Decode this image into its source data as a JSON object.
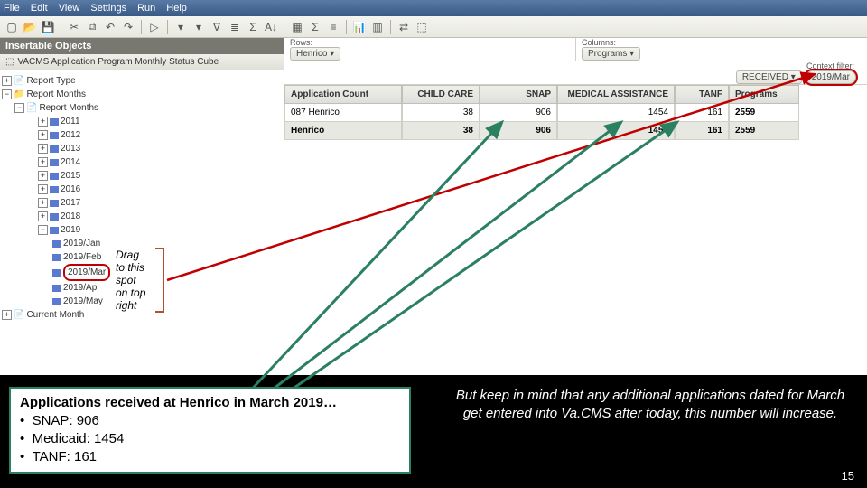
{
  "menu": {
    "items": [
      "File",
      "Edit",
      "View",
      "Settings",
      "Run",
      "Help"
    ]
  },
  "sidebar": {
    "title": "Insertable Objects",
    "source": "VACMS Application Program Monthly Status Cube",
    "top_items": [
      "Report Type",
      "Report Months"
    ],
    "years": [
      "2011",
      "2012",
      "2013",
      "2014",
      "2015",
      "2016",
      "2017",
      "2018",
      "2019"
    ],
    "months_2019": [
      "2019/Jan",
      "2019/Feb",
      "2019/Mar",
      "2019/Ap",
      "2019/May"
    ],
    "bottom_item": "Current Month"
  },
  "zones": {
    "rows_label": "Rows:",
    "rows_chip": "Henrico ▾",
    "cols_label": "Columns:",
    "cols_chip": "Programs ▾",
    "ctx_label": "Context filter:",
    "ctx_chip1": "RECEIVED ▾",
    "ctx_chip2": "2019/Mar"
  },
  "table": {
    "headers": [
      "Application Count",
      "CHILD CARE",
      "SNAP",
      "MEDICAL ASSISTANCE",
      "TANF",
      "Programs"
    ],
    "row1": {
      "label": "087   Henrico",
      "vals": [
        "38",
        "906",
        "1454",
        "161",
        "2559"
      ]
    },
    "row2": {
      "label": "Henrico",
      "vals": [
        "38",
        "906",
        "1454",
        "161",
        "2559"
      ]
    }
  },
  "drag_hint": {
    "l1": "Drag",
    "l2": "to this",
    "l3": "spot",
    "l4": "on top",
    "l5": "right"
  },
  "notes": {
    "left_title": "Applications received at Henrico in March 2019…",
    "left_b1": "SNAP:           906",
    "left_b2": "Medicaid:        1454",
    "left_b3": "TANF:                  161",
    "right": "But keep in mind that any additional applications dated for March get entered into Va.CMS after today, this number will increase."
  },
  "page": "15",
  "chart_data": {
    "type": "table",
    "title": "Applications received at Henrico in March 2019",
    "categories": [
      "CHILD CARE",
      "SNAP",
      "MEDICAL ASSISTANCE",
      "TANF",
      "Programs (Total)"
    ],
    "values": [
      38,
      906,
      1454,
      161,
      2559
    ]
  }
}
